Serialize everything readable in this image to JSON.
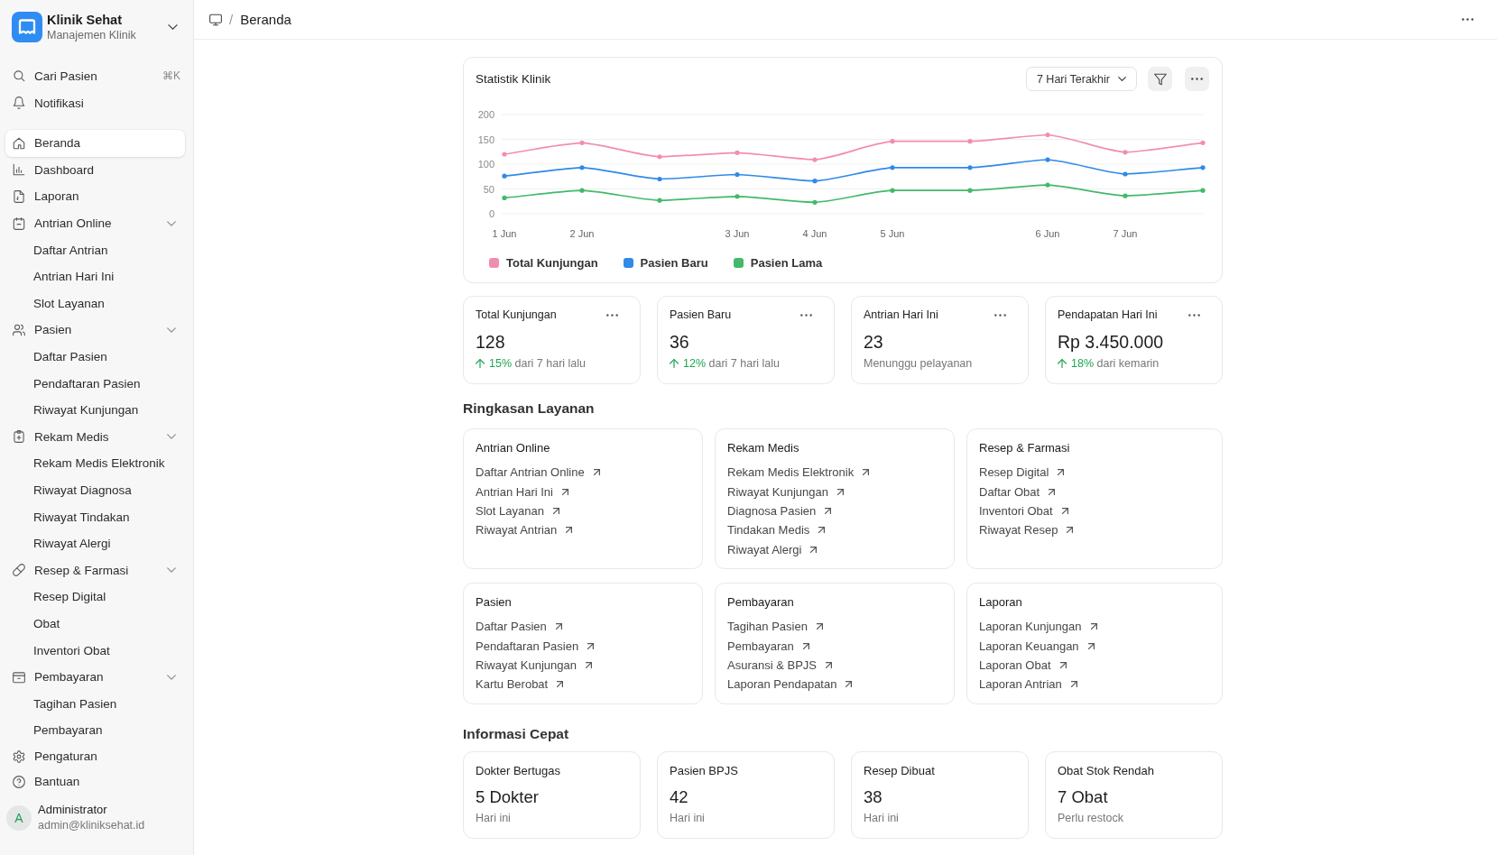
{
  "sidebar": {
    "brand": {
      "title": "Klinik Sehat",
      "subtitle": "Manajemen Klinik"
    },
    "quick_actions": [
      {
        "label": "Cari Pasien",
        "shortcut": "⌘K"
      },
      {
        "label": "Notifikasi"
      }
    ],
    "nav": [
      {
        "label": "Beranda",
        "selected": true
      },
      {
        "label": "Dashboard",
        "selected": false
      },
      {
        "label": "Laporan",
        "selected": false
      },
      {
        "label": "Antrian Online",
        "selected": false,
        "expanded": true,
        "children": [
          {
            "label": "Daftar Antrian",
            "selected": false
          },
          {
            "label": "Antrian Hari Ini",
            "selected": false
          },
          {
            "label": "Slot Layanan",
            "selected": false
          }
        ]
      },
      {
        "label": "Pasien",
        "selected": false,
        "expanded": true,
        "children": [
          {
            "label": "Daftar Pasien",
            "selected": false
          },
          {
            "label": "Pendaftaran Pasien",
            "selected": false
          },
          {
            "label": "Riwayat Kunjungan",
            "selected": false
          }
        ]
      },
      {
        "label": "Rekam Medis",
        "selected": false,
        "expanded": true,
        "children": [
          {
            "label": "Rekam Medis Elektronik",
            "selected": false
          },
          {
            "label": "Riwayat Diagnosa",
            "selected": false
          },
          {
            "label": "Riwayat Tindakan",
            "selected": false
          },
          {
            "label": "Riwayat Alergi",
            "selected": false
          }
        ]
      },
      {
        "label": "Resep & Farmasi",
        "selected": false,
        "expanded": true,
        "children": [
          {
            "label": "Resep Digital",
            "selected": false
          },
          {
            "label": "Obat",
            "selected": false
          },
          {
            "label": "Inventori Obat",
            "selected": false
          }
        ]
      },
      {
        "label": "Pembayaran",
        "selected": false,
        "expanded": true,
        "children": [
          {
            "label": "Tagihan Pasien",
            "selected": false
          },
          {
            "label": "Pembayaran",
            "selected": false
          }
        ]
      }
    ],
    "secondary_nav": [
      {
        "label": "Pengaturan",
        "selected": false
      },
      {
        "label": "Bantuan",
        "selected": false
      }
    ],
    "user": {
      "initial": "A",
      "name": "Administrator",
      "email": "admin@kliniksehat.id"
    }
  },
  "header": {
    "separator": "/",
    "breadcrumb": [
      {
        "label": "Beranda"
      }
    ]
  },
  "chart_card": {
    "title": "Statistik Klinik",
    "range": "7 Hari Terakhir",
    "chart_data": {
      "type": "line",
      "grid": true,
      "categories": [
        "1 Jun",
        "2 Jun",
        null,
        "3 Jun",
        "4 Jun",
        "5 Jun",
        null,
        "6 Jun",
        "7 Jun",
        null
      ],
      "ylim": [
        0,
        200
      ],
      "yticks": [
        0,
        50,
        100,
        150,
        200
      ],
      "series": [
        {
          "name": "Total Kunjungan",
          "color": "#f28db2",
          "values": [
            120,
            143,
            115,
            123,
            109,
            146,
            146,
            159,
            124,
            143
          ]
        },
        {
          "name": "Pasien Baru",
          "color": "#2f8ae8",
          "values": [
            76,
            93,
            70,
            79,
            66,
            93,
            93,
            109,
            80,
            93
          ]
        },
        {
          "name": "Pasien Lama",
          "color": "#43b96a",
          "values": [
            32,
            47,
            27,
            35,
            23,
            47,
            47,
            58,
            36,
            47
          ]
        }
      ]
    }
  },
  "stats": [
    {
      "kind": "trend",
      "title": "Total Kunjungan",
      "value": "128",
      "rising": true,
      "caption": "**15%** dari 7 hari lalu"
    },
    {
      "kind": "trend",
      "title": "Pasien Baru",
      "value": "36",
      "rising": true,
      "caption": "**12%** dari 7 hari lalu"
    },
    {
      "kind": "note",
      "title": "Antrian Hari Ini",
      "value": "23",
      "caption": "Menunggu pelayanan"
    },
    {
      "kind": "trend",
      "title": "Pendapatan Hari Ini",
      "value": "Rp 3.450.000",
      "rising": true,
      "caption": "**18%** dari kemarin"
    }
  ],
  "services": {
    "title": "Ringkasan Layanan",
    "groups": [
      {
        "title": "Antrian Online",
        "links": [
          "Daftar Antrian Online",
          "Antrian Hari Ini",
          "Slot Layanan",
          "Riwayat Antrian"
        ]
      },
      {
        "title": "Rekam Medis",
        "links": [
          "Rekam Medis Elektronik",
          "Riwayat Kunjungan",
          "Diagnosa Pasien",
          "Tindakan Medis",
          "Riwayat Alergi"
        ]
      },
      {
        "title": "Resep & Farmasi",
        "links": [
          "Resep Digital",
          "Daftar Obat",
          "Inventori Obat",
          "Riwayat Resep"
        ]
      },
      {
        "title": "Pasien",
        "links": [
          "Daftar Pasien",
          "Pendaftaran Pasien",
          "Riwayat Kunjungan",
          "Kartu Berobat"
        ]
      },
      {
        "title": "Pembayaran",
        "links": [
          "Tagihan Pasien",
          "Pembayaran",
          "Asuransi & BPJS",
          "Laporan Pendapatan"
        ]
      },
      {
        "title": "Laporan",
        "links": [
          "Laporan Kunjungan",
          "Laporan Keuangan",
          "Laporan Obat",
          "Laporan Antrian"
        ]
      }
    ]
  },
  "quick_info": {
    "title": "Informasi Cepat",
    "cards": [
      {
        "title": "Dokter Bertugas",
        "value": "5 Dokter",
        "caption": "Hari ini"
      },
      {
        "title": "Pasien BPJS",
        "value": "42",
        "caption": "Hari ini"
      },
      {
        "title": "Resep Dibuat",
        "value": "38",
        "caption": "Hari ini"
      },
      {
        "title": "Obat Stok Rendah",
        "value": "7 Obat",
        "caption": "Perlu restock"
      }
    ]
  }
}
